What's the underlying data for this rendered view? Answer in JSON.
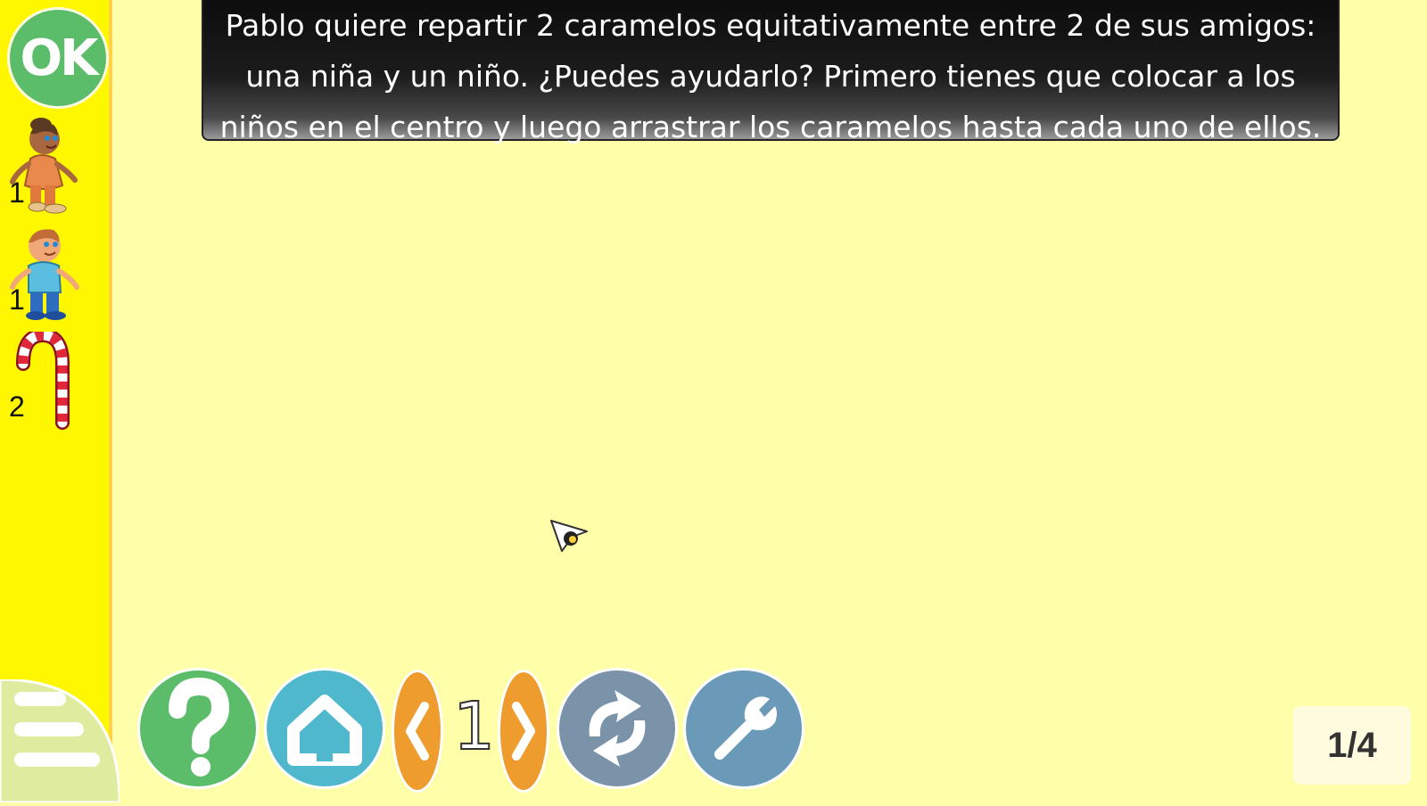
{
  "sidebar": {
    "ok_label": "OK",
    "items": [
      {
        "name": "girl",
        "count": "1"
      },
      {
        "name": "boy",
        "count": "1"
      },
      {
        "name": "candy-cane",
        "count": "2"
      }
    ]
  },
  "question": {
    "text": "Pablo quiere repartir 2 caramelos equitativamente entre 2 de sus amigos: una niña y un niño. ¿Puedes ayudarlo? Primero tienes que colocar a los niños en el centro y luego arrastrar los caramelos hasta cada uno de ellos."
  },
  "toolbar": {
    "help_icon": "question-icon",
    "home_icon": "home-icon",
    "prev_icon": "chevron-left-icon",
    "page_number": "1",
    "next_icon": "chevron-right-icon",
    "reload_icon": "refresh-icon",
    "settings_icon": "wrench-icon"
  },
  "progress": "1/4",
  "colors": {
    "background": "#ffffa9",
    "sidebar": "#fff700",
    "ok_green": "#5bbd6a",
    "help_green": "#5bbd6a",
    "home_teal": "#4fb8cd",
    "arrow_orange": "#ee9c2e",
    "reload_gray": "#7a93a8",
    "settings_blue": "#6a9ab8"
  }
}
